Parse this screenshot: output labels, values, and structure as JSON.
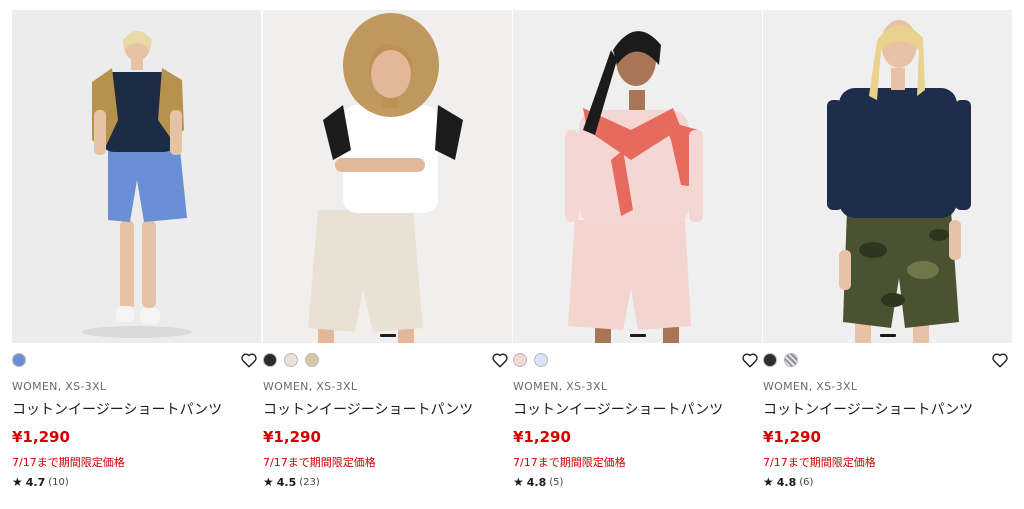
{
  "products": [
    {
      "category": "WOMEN, XS-3XL",
      "name": "コットンイージーショートパンツ",
      "price": "¥1,290",
      "promo": "7/17まで期間限定価格",
      "rating": "4.7",
      "review_count": "(10)",
      "colors": [
        "#6b8fd6"
      ],
      "swatch_labels": [
        "blue"
      ],
      "favorite_icon": "heart-outline-icon"
    },
    {
      "category": "WOMEN, XS-3XL",
      "name": "コットンイージーショートパンツ",
      "price": "¥1,290",
      "promo": "7/17まで期間限定価格",
      "rating": "4.5",
      "review_count": "(23)",
      "colors": [
        "#2b2b2b",
        "#ebe4d8",
        "#d8c9a8"
      ],
      "swatch_labels": [
        "black",
        "off-white",
        "beige"
      ],
      "favorite_icon": "heart-outline-icon"
    },
    {
      "category": "WOMEN, XS-3XL",
      "name": "コットンイージーショートパンツ",
      "price": "¥1,290",
      "promo": "7/17まで期間限定価格",
      "rating": "4.8",
      "review_count": "(5)",
      "colors": [
        "#f4d9da",
        "#dbe6f8"
      ],
      "swatch_labels": [
        "pink",
        "light-blue"
      ],
      "favorite_icon": "heart-outline-icon"
    },
    {
      "category": "WOMEN, XS-3XL",
      "name": "コットンイージーショートパンツ",
      "price": "¥1,290",
      "promo": "7/17まで期間限定価格",
      "rating": "4.8",
      "review_count": "(6)",
      "colors": [
        "#2e2e2e",
        "#8a8f9a"
      ],
      "swatch_labels": [
        "black",
        "pattern"
      ],
      "favorite_icon": "heart-outline-icon"
    }
  ],
  "accent": {
    "price_red": "#d40000",
    "text": "#1b1b1b",
    "meta_gray": "#6b6b6b"
  }
}
